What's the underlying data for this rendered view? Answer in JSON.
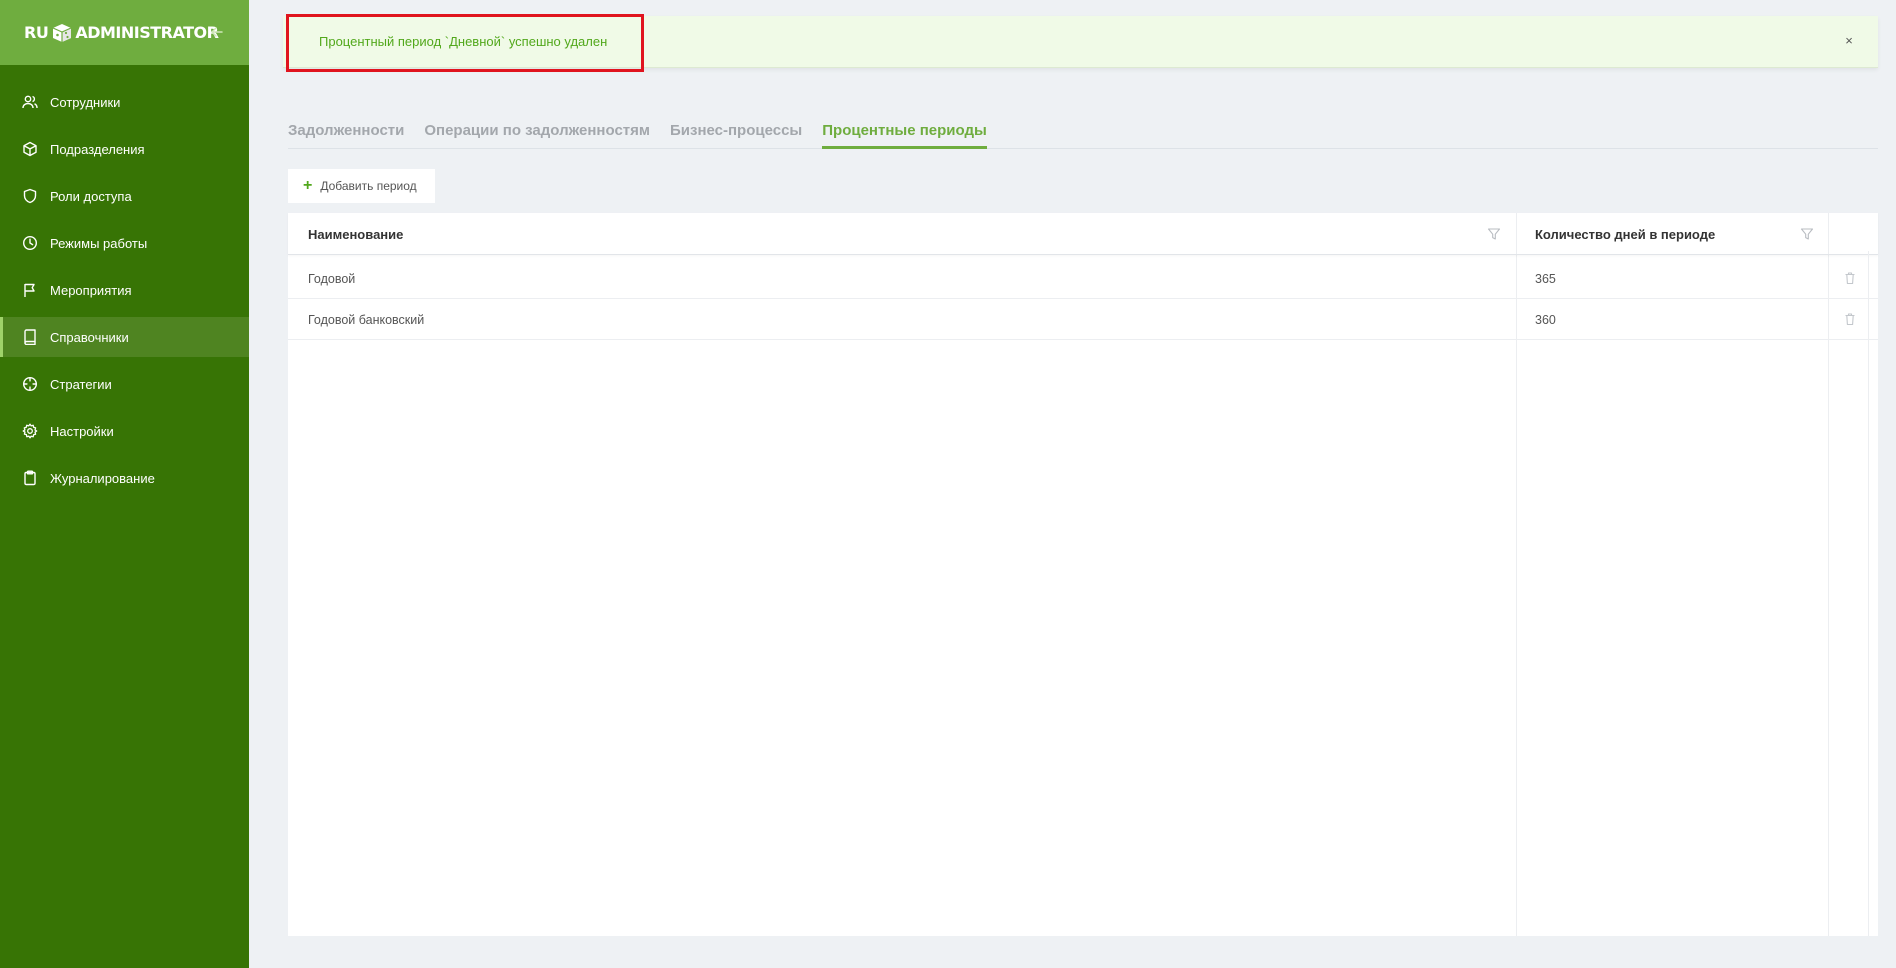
{
  "app": {
    "logo_left": "RU",
    "logo_right": "ADMINISTRATOR"
  },
  "sidebar": {
    "items": [
      {
        "label": "Сотрудники",
        "icon": "users-icon"
      },
      {
        "label": "Подразделения",
        "icon": "cube-icon"
      },
      {
        "label": "Роли доступа",
        "icon": "shield-icon"
      },
      {
        "label": "Режимы работы",
        "icon": "clock-icon"
      },
      {
        "label": "Мероприятия",
        "icon": "flag-icon"
      },
      {
        "label": "Справочники",
        "icon": "book-icon",
        "active": true
      },
      {
        "label": "Стратегии",
        "icon": "crosshair-icon"
      },
      {
        "label": "Настройки",
        "icon": "gear-icon"
      },
      {
        "label": "Журналирование",
        "icon": "clipboard-icon"
      }
    ]
  },
  "notification": {
    "text": "Процентный период `Дневной` успешно удален",
    "close": "×"
  },
  "tabs": [
    {
      "label": "Задолженности",
      "active": false
    },
    {
      "label": "Операции по задолженностям",
      "active": false
    },
    {
      "label": "Бизнес-процессы",
      "active": false
    },
    {
      "label": "Процентные периоды",
      "active": true
    }
  ],
  "toolbar": {
    "add_label": "Добавить период"
  },
  "table": {
    "columns": [
      "Наименование",
      "Количество дней в периоде"
    ],
    "rows": [
      {
        "name": "Годовой",
        "days": "365"
      },
      {
        "name": "Годовой банковский",
        "days": "360"
      }
    ]
  },
  "colors": {
    "sidebar": "#377405",
    "sidebar_header": "#6fad3f",
    "accent": "#6fad3f",
    "notify_bg": "#f0fae7",
    "highlight_frame": "#e0141e"
  }
}
